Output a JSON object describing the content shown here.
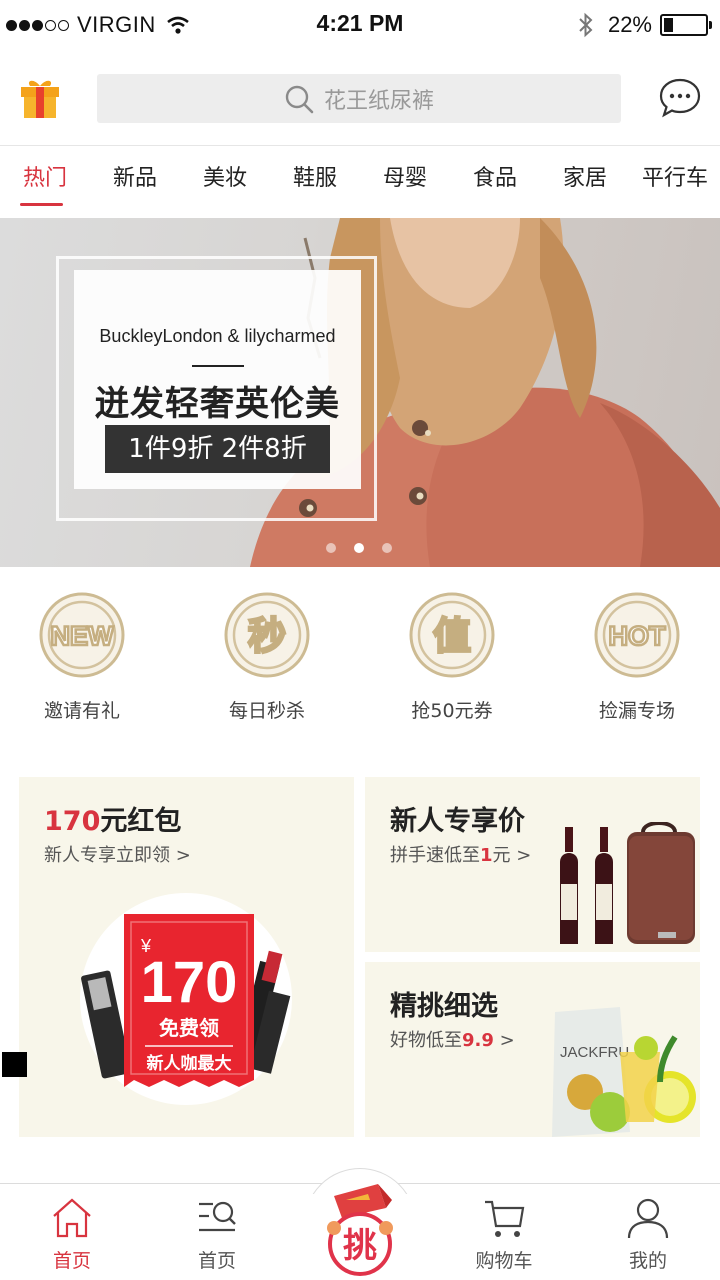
{
  "status_bar": {
    "carrier": "VIRGIN",
    "time": "4:21 PM",
    "battery_percent_text": "22%",
    "battery_level": 0.22,
    "signal_bars_filled": 3,
    "signal_bars_total": 5
  },
  "header": {
    "search_placeholder": "花王纸尿裤",
    "left_icon": "gift-icon",
    "right_icon": "message-icon"
  },
  "categories": [
    {
      "label": "热门",
      "active": true
    },
    {
      "label": "新品"
    },
    {
      "label": "美妆"
    },
    {
      "label": "鞋服"
    },
    {
      "label": "母婴"
    },
    {
      "label": "食品"
    },
    {
      "label": "家居"
    },
    {
      "label": "平行车"
    }
  ],
  "banner": {
    "brand": "BuckleyLondon & lilycharmed",
    "headline": "迸发轻奢英伦美",
    "promo": "1件9折 2件8折",
    "slide_count": 3,
    "active_slide": 1
  },
  "quick_entries": [
    {
      "badge": "NEW",
      "label": "邀请有礼",
      "icon": "new-badge-icon"
    },
    {
      "badge": "秒",
      "label": "每日秒杀",
      "icon": "flash-sale-icon"
    },
    {
      "badge": "值",
      "label": "抢50元券",
      "icon": "value-coupon-icon"
    },
    {
      "badge": "HOT",
      "label": "捡漏专场",
      "icon": "hot-badge-icon"
    }
  ],
  "promos": {
    "red_packet": {
      "title_accent": "170",
      "title_rest": "元红包",
      "subtitle": "新人专享立即领 >",
      "coupon_currency": "¥",
      "coupon_amount": "170",
      "coupon_line1": "免费领",
      "coupon_line2": "新人咖最大"
    },
    "newcomer": {
      "title": "新人专享价",
      "subtitle_prefix": "拼手速低至",
      "subtitle_accent": "1",
      "subtitle_suffix": "元 >"
    },
    "selection": {
      "title": "精挑细选",
      "subtitle_prefix": "好物低至",
      "subtitle_accent": "9.9",
      "subtitle_suffix": " >",
      "product_label": "JACKFRU"
    }
  },
  "tabbar": {
    "items": [
      {
        "label": "首页",
        "icon": "home-icon",
        "active": true
      },
      {
        "label": "首页",
        "icon": "discover-icon"
      },
      {
        "label": "挑",
        "icon": "pick-center-icon"
      },
      {
        "label": "购物车",
        "icon": "cart-icon"
      },
      {
        "label": "我的",
        "icon": "profile-icon"
      }
    ]
  },
  "colors": {
    "accent": "#d8343f",
    "gold": "#c9b48a",
    "promo_bg": "#f8f6ea"
  }
}
